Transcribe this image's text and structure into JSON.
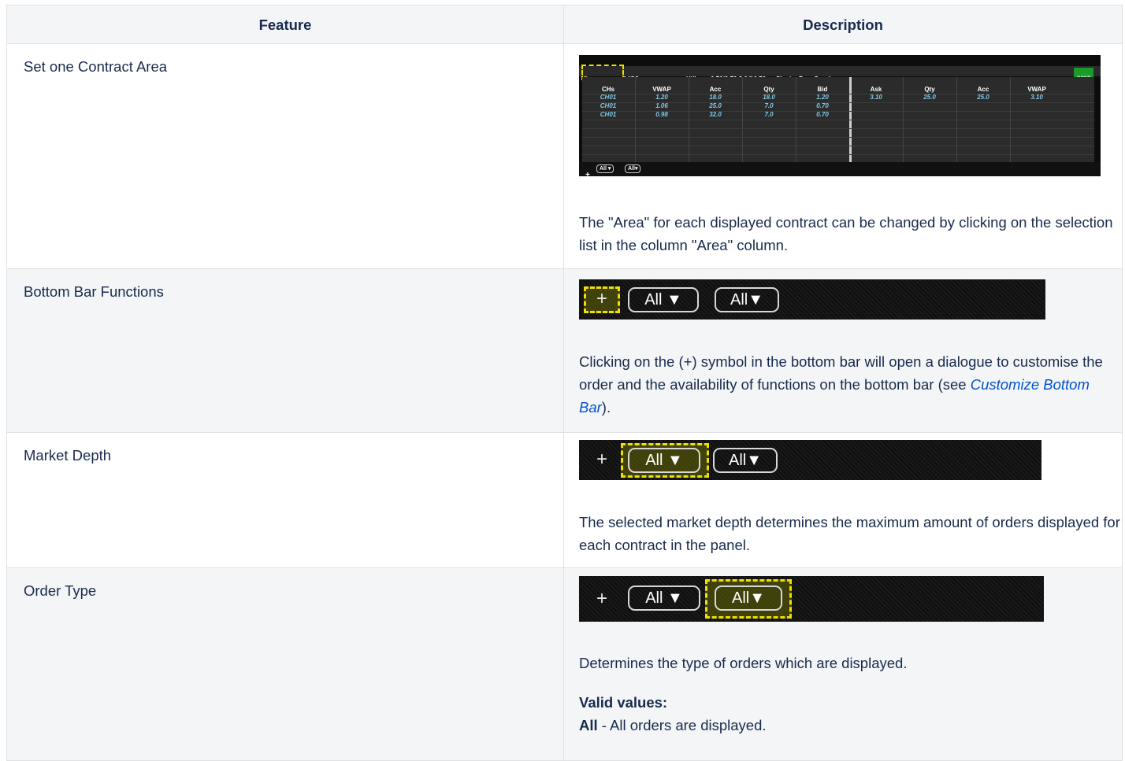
{
  "table": {
    "headers": [
      "Feature",
      "Description"
    ],
    "rows": [
      {
        "feature": "Set one Contract Area",
        "description": "The \"Area\" for each displayed contract can be changed by clicking on the selection list in the column \"Area\" column."
      },
      {
        "feature": "Bottom Bar Functions",
        "description_before_link": "Clicking on the (+) symbol in the bottom bar will open a dialogue to customise the order and the availability of functions on the bottom bar (see ",
        "link_text": "Customize Bottom Bar",
        "description_after_link": ")."
      },
      {
        "feature": "Market Depth",
        "description": "The selected market depth determines the maximum amount of orders displayed for each contract in the panel."
      },
      {
        "feature": "Order Type",
        "description": "Determines the type of orders which are displayed.",
        "valid_values_label": "Valid values:",
        "value_name": "All",
        "value_text": " - All orders are displayed."
      }
    ]
  },
  "bottom_bar": {
    "plus": "+",
    "depth_label": "All ▼",
    "type_label": "All▼",
    "highlight_color": "#f0e000"
  },
  "order_book": {
    "title": "▸ Order Book Details",
    "area_label": "Demo ▾",
    "contract": "14Q3",
    "hilow": "Hi/Low:  0.70/0.70   8.0@0.70 → ClosingPx:  -  Surplus:  -",
    "status": "CONT",
    "headers": [
      "CHs",
      "VWAP",
      "Acc",
      "Qty",
      "Bid",
      "Ask",
      "Qty",
      "Acc",
      "VWAP"
    ],
    "rows": [
      [
        "CH01",
        "1.20",
        "18.0",
        "18.0",
        "1.20",
        "3.10",
        "25.0",
        "25.0",
        "3.10"
      ],
      [
        "CH01",
        "1.06",
        "25.0",
        "7.0",
        "0.70",
        "",
        "",
        "",
        ""
      ],
      [
        "CH01",
        "0.98",
        "32.0",
        "7.0",
        "0.70",
        "",
        "",
        "",
        ""
      ]
    ],
    "footer_plus": "+",
    "footer_depth": "All ▾",
    "footer_type": "All▾"
  }
}
